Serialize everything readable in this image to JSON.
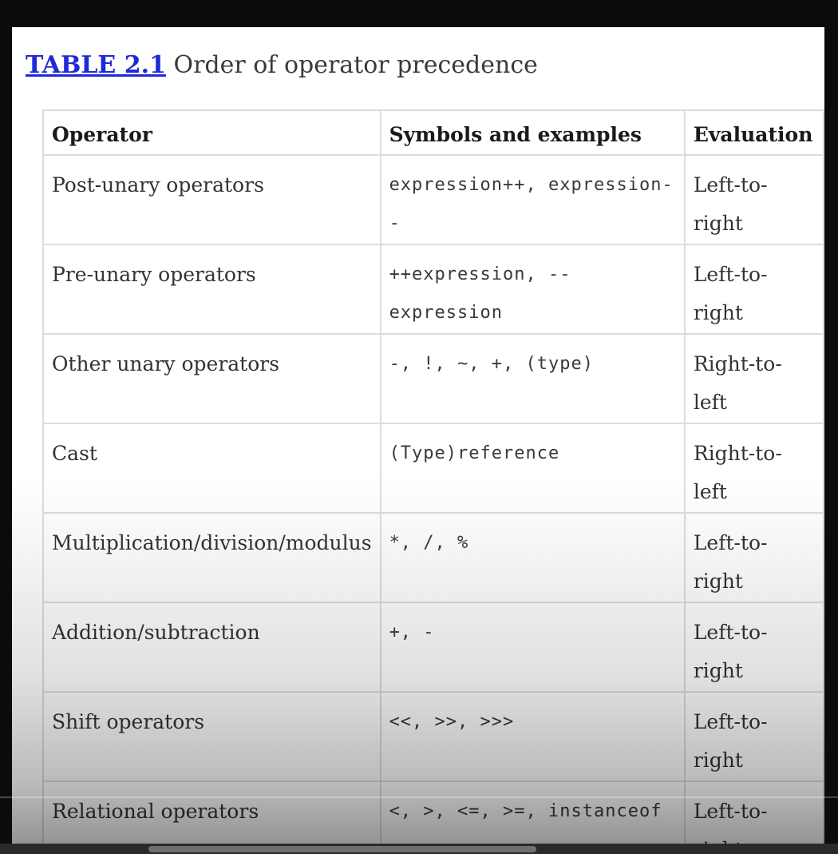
{
  "caption": {
    "number": "TABLE 2.1",
    "title": "Order of operator precedence"
  },
  "table": {
    "headers": [
      "Operator",
      "Symbols and examples",
      "Evaluation"
    ],
    "rows": [
      {
        "operator": "Post-unary operators",
        "symbols": "expression++, expression--",
        "evaluation": "Left-to-right"
      },
      {
        "operator": "Pre-unary operators",
        "symbols": "++expression, --expression",
        "evaluation": "Left-to-right"
      },
      {
        "operator": "Other unary operators",
        "symbols": "-, !, ~, +, (type)",
        "evaluation": "Right-to-left"
      },
      {
        "operator": "Cast",
        "symbols": "(Type)reference",
        "evaluation": "Right-to-left"
      },
      {
        "operator": "Multiplication/division/modulus",
        "symbols": "*, /, %",
        "evaluation": "Left-to-right"
      },
      {
        "operator": "Addition/subtraction",
        "symbols": "+, -",
        "evaluation": "Left-to-right"
      },
      {
        "operator": "Shift operators",
        "symbols": "<<, >>, >>>",
        "evaluation": "Left-to-right"
      },
      {
        "operator": "Relational operators",
        "symbols": "<, >, <=, >=, instanceof",
        "evaluation": "Left-to-right"
      }
    ]
  },
  "colors": {
    "caption_link": "#1f2ad6",
    "border": "#dcdcdc",
    "text": "#333333"
  }
}
